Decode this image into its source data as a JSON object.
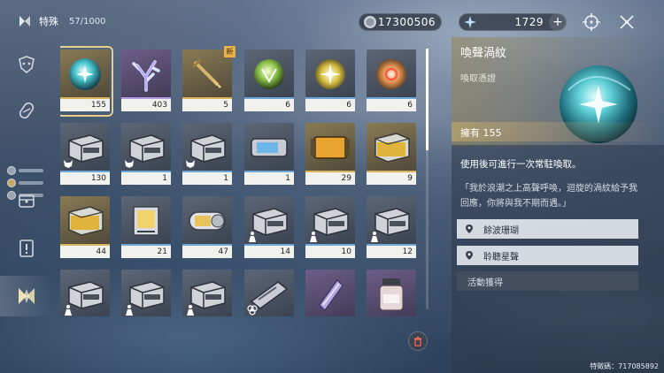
{
  "header": {
    "category": "特殊",
    "count": "57/1000"
  },
  "currencies": {
    "primary": {
      "icon": "coin-icon",
      "value": "17300506"
    },
    "secondary": {
      "icon": "star-currency-icon",
      "value": "1729",
      "add_label": "+"
    }
  },
  "sidebar": {
    "items": [
      {
        "name": "sidebar-item-echo",
        "icon": "echo-mask-icon"
      },
      {
        "name": "sidebar-item-material",
        "icon": "leaf-capsule-icon"
      },
      {
        "name": "sidebar-item-resource",
        "icon": "chest-icon"
      },
      {
        "name": "sidebar-item-quest",
        "icon": "exclamation-icon"
      },
      {
        "name": "sidebar-item-special",
        "icon": "special-diamond-icon"
      }
    ]
  },
  "grid": {
    "items": [
      {
        "count": "155",
        "art": "orb-cyan",
        "quality": "q5",
        "selected": true
      },
      {
        "count": "403",
        "art": "coral",
        "quality": "q4"
      },
      {
        "count": "5",
        "art": "dagger",
        "quality": "q5",
        "badge": "新"
      },
      {
        "count": "6",
        "art": "orb-green",
        "quality": "q3"
      },
      {
        "count": "6",
        "art": "orb-yellow",
        "quality": "q3"
      },
      {
        "count": "6",
        "art": "orb-orange",
        "quality": "q3"
      },
      {
        "count": "130",
        "art": "box-gray",
        "quality": "q3",
        "sub": "wolf"
      },
      {
        "count": "1",
        "art": "box-gray",
        "quality": "q3",
        "sub": "wolf"
      },
      {
        "count": "1",
        "art": "box-gray",
        "quality": "q3",
        "sub": "wolf"
      },
      {
        "count": "1",
        "art": "capsule-blue",
        "quality": "q3"
      },
      {
        "count": "29",
        "art": "capsule-gold",
        "quality": "q5"
      },
      {
        "count": "9",
        "art": "box-gold",
        "quality": "q5"
      },
      {
        "count": "44",
        "art": "box-gold",
        "quality": "q5"
      },
      {
        "count": "21",
        "art": "cage",
        "quality": "q3"
      },
      {
        "count": "47",
        "art": "canister",
        "quality": "q3"
      },
      {
        "count": "14",
        "art": "box-gray",
        "quality": "q3",
        "sub": "figure"
      },
      {
        "count": "10",
        "art": "box-gray",
        "quality": "q3",
        "sub": "figure"
      },
      {
        "count": "12",
        "art": "box-gray",
        "quality": "q3",
        "sub": "figure"
      },
      {
        "count": "",
        "art": "box-gray",
        "quality": "q3",
        "sub": "figure"
      },
      {
        "count": "",
        "art": "box-gray",
        "quality": "q3",
        "sub": "figure"
      },
      {
        "count": "",
        "art": "box-gray",
        "quality": "q3",
        "sub": "figure"
      },
      {
        "count": "",
        "art": "card",
        "quality": "q3",
        "sub": "clover"
      },
      {
        "count": "",
        "art": "crystal",
        "quality": "q4"
      },
      {
        "count": "",
        "art": "jar",
        "quality": "q4"
      }
    ]
  },
  "detail": {
    "title": "喚聲渦紋",
    "type": "喚取憑證",
    "own": "擁有 155",
    "use_description": "使用後可進行一次常駐喚取。",
    "flavor": "「我於浪潮之上高聲呼喚，迴旋的渦紋給予我回應，你將與我不期而遇。」",
    "sources": [
      {
        "label": "餘波珊瑚",
        "icon": "location-pin-icon"
      },
      {
        "label": "聆聽星聲",
        "icon": "location-pin-icon"
      },
      {
        "label": "活動獲得",
        "icon": ""
      }
    ]
  },
  "footer": {
    "uid": "特徵碼：717085892"
  },
  "colors": {
    "accent_gold": "#e6cf8c",
    "quality_gold": "#d8b55c",
    "quality_purple": "#b49be0",
    "quality_blue": "#6fa6d8"
  }
}
